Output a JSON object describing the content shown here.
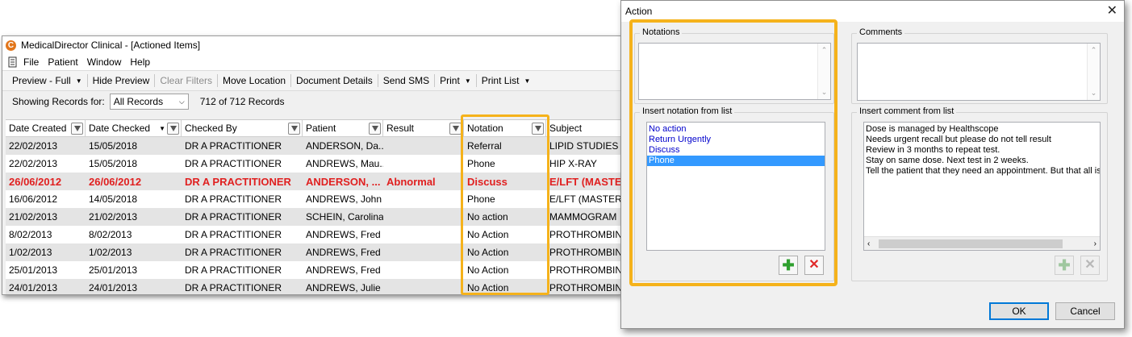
{
  "main_window": {
    "title": "MedicalDirector Clinical - [Actioned Items]",
    "app_icon": "C",
    "menu": [
      "File",
      "Patient",
      "Window",
      "Help"
    ],
    "toolbar": [
      {
        "label": "Preview - Full",
        "dropdown": true,
        "disabled": false
      },
      {
        "label": "Hide Preview",
        "dropdown": false,
        "disabled": false
      },
      {
        "label": "Clear Filters",
        "dropdown": false,
        "disabled": true
      },
      {
        "label": "Move Location",
        "dropdown": false,
        "disabled": false
      },
      {
        "label": "Document Details",
        "dropdown": false,
        "disabled": false
      },
      {
        "label": "Send SMS",
        "dropdown": false,
        "disabled": false
      },
      {
        "label": "Print",
        "dropdown": true,
        "disabled": false
      },
      {
        "label": "Print List",
        "dropdown": true,
        "disabled": false
      }
    ],
    "filter": {
      "label": "Showing Records for:",
      "selected": "All Records",
      "record_count": "712 of 712 Records"
    },
    "columns": [
      "Date Created",
      "Date Checked",
      "Checked By",
      "Patient",
      "Result",
      "Notation",
      "Subject"
    ],
    "rows": [
      {
        "date_created": "22/02/2013",
        "date_checked": "15/05/2018",
        "checked_by": "DR A PRACTITIONER",
        "patient": "ANDERSON, Da...",
        "result": "",
        "notation": "Referral",
        "subject": "LIPID STUDIES",
        "abnormal": false
      },
      {
        "date_created": "22/02/2013",
        "date_checked": "15/05/2018",
        "checked_by": "DR A PRACTITIONER",
        "patient": "ANDREWS, Mau...",
        "result": "",
        "notation": "Phone",
        "subject": "HIP X-RAY",
        "abnormal": false
      },
      {
        "date_created": "26/06/2012",
        "date_checked": "26/06/2012",
        "checked_by": "DR A PRACTITIONER",
        "patient": "ANDERSON, ...",
        "result": "Abnormal",
        "notation": "Discuss",
        "subject": "E/LFT (MASTER)",
        "abnormal": true
      },
      {
        "date_created": "16/06/2012",
        "date_checked": "14/05/2018",
        "checked_by": "DR A PRACTITIONER",
        "patient": "ANDREWS, John",
        "result": "",
        "notation": "Phone",
        "subject": "E/LFT (MASTER)",
        "abnormal": false
      },
      {
        "date_created": "21/02/2013",
        "date_checked": "21/02/2013",
        "checked_by": "DR A PRACTITIONER",
        "patient": "SCHEIN, Carolina",
        "result": "",
        "notation": "No action",
        "subject": "MAMMOGRAM",
        "abnormal": false
      },
      {
        "date_created": "8/02/2013",
        "date_checked": "8/02/2013",
        "checked_by": "DR A PRACTITIONER",
        "patient": "ANDREWS, Fred",
        "result": "",
        "notation": "No Action",
        "subject": "PROTHROMBIN C",
        "abnormal": false
      },
      {
        "date_created": "1/02/2013",
        "date_checked": "1/02/2013",
        "checked_by": "DR A PRACTITIONER",
        "patient": "ANDREWS, Fred",
        "result": "",
        "notation": "No Action",
        "subject": "PROTHROMBIN C",
        "abnormal": false
      },
      {
        "date_created": "25/01/2013",
        "date_checked": "25/01/2013",
        "checked_by": "DR A PRACTITIONER",
        "patient": "ANDREWS, Fred",
        "result": "",
        "notation": "No Action",
        "subject": "PROTHROMBIN C",
        "abnormal": false
      },
      {
        "date_created": "24/01/2013",
        "date_checked": "24/01/2013",
        "checked_by": "DR A PRACTITIONER",
        "patient": "ANDREWS, Julie",
        "result": "",
        "notation": "No Action",
        "subject": "PROTHROMBIN C",
        "abnormal": false
      }
    ]
  },
  "dialog": {
    "title": "Action",
    "notations": {
      "label": "Notations",
      "value": "",
      "list_label": "Insert notation from list",
      "items": [
        "No action",
        "Return Urgently",
        "Discuss",
        "Phone"
      ],
      "selected_index": 3
    },
    "comments": {
      "label": "Comments",
      "value": "",
      "list_label": "Insert comment from list",
      "items": [
        "Dose is managed by Healthscope",
        "Needs urgent recall but please do not tell result",
        "Review in 3 months to repeat test.",
        "Stay on same dose. Next test in 2 weeks.",
        "Tell the patient that they need an appointment.  But that all is"
      ]
    },
    "ok_label": "OK",
    "cancel_label": "Cancel"
  },
  "colors": {
    "highlight": "#f5b21b",
    "abnormal": "#e02020",
    "selection": "#3399ff",
    "list_text": "#0000cc"
  }
}
